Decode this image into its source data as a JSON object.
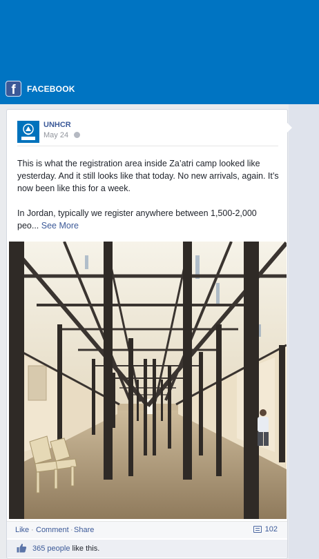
{
  "header": {
    "brand_label": "FACEBOOK",
    "brand_icon": "facebook-logo-icon",
    "background_color": "#0074c2"
  },
  "post": {
    "page_name": "UNHCR",
    "avatar_label": "UNHCR",
    "date": "May 24",
    "paragraph1": "This is what the registration area inside Za’atri camp looked like yesterday. And it still looks like that today. No new arrivals, again. It’s now been like this for a week.",
    "paragraph2": "In Jordan, typically we register anywhere between 1,500-2,000 peo...",
    "see_more": "See More",
    "photo_description_icon": "registration-hall-photo"
  },
  "actions": {
    "like": "Like",
    "comment": "Comment",
    "share": "Share",
    "separator": "·",
    "comment_count": "102"
  },
  "likes": {
    "count_link": "365 people",
    "suffix": " like this."
  },
  "colors": {
    "link": "#3b5998",
    "page_background": "#e9ebee"
  }
}
